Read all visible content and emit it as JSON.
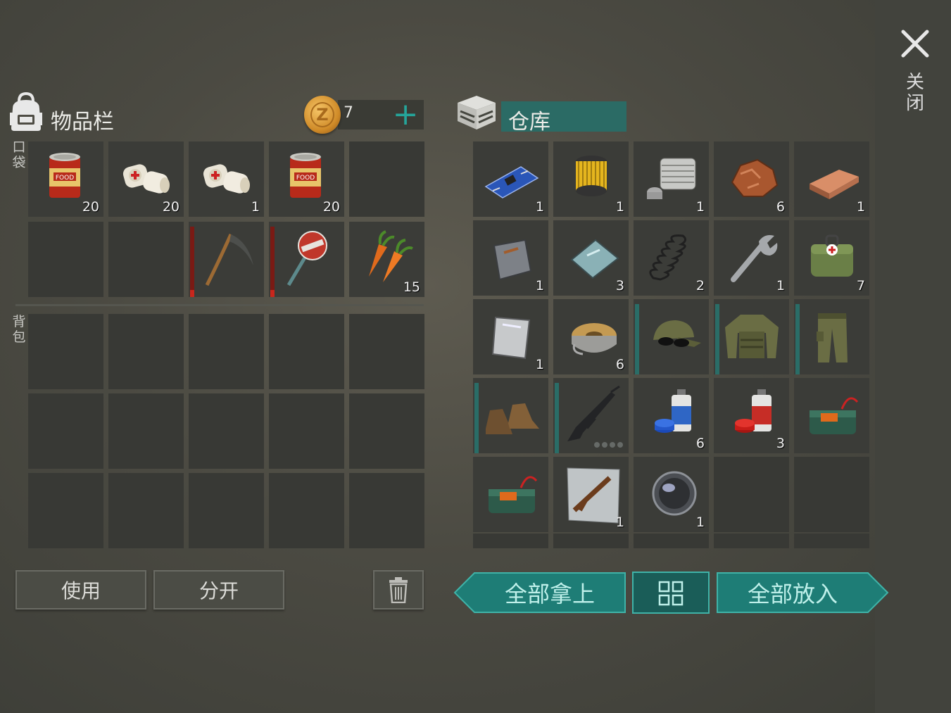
{
  "inventory": {
    "title": "物品栏",
    "coins": "7",
    "pocket_label": "口袋",
    "backpack_label": "背包"
  },
  "pocket": [
    {
      "icon": "food-can-icon",
      "count": "20"
    },
    {
      "icon": "bandage-icon",
      "count": "20"
    },
    {
      "icon": "bandage-icon",
      "count": "1"
    },
    {
      "icon": "food-can-icon",
      "count": "20"
    },
    {
      "icon": null,
      "count": ""
    },
    {
      "icon": null,
      "count": ""
    },
    {
      "icon": null,
      "count": ""
    },
    {
      "icon": "scythe-icon",
      "count": "",
      "durability": 0.08
    },
    {
      "icon": "stop-sign-icon",
      "count": "",
      "durability": 0.08
    },
    {
      "icon": "carrot-icon",
      "count": "15"
    }
  ],
  "storage": {
    "title": "仓库"
  },
  "storage_items": [
    {
      "icon": "circuit-board-icon",
      "count": "1"
    },
    {
      "icon": "air-filter-icon",
      "count": "1"
    },
    {
      "icon": "engine-cylinder-icon",
      "count": "1"
    },
    {
      "icon": "copper-ore-icon",
      "count": "6"
    },
    {
      "icon": "copper-ingot-icon",
      "count": "1"
    },
    {
      "icon": "metal-plate-icon",
      "count": "1"
    },
    {
      "icon": "glass-plate-icon",
      "count": "3"
    },
    {
      "icon": "spring-icon",
      "count": "2"
    },
    {
      "icon": "wrench-icon",
      "count": "1"
    },
    {
      "icon": "medical-bag-icon",
      "count": "7"
    },
    {
      "icon": "aluminum-plate-icon",
      "count": "1"
    },
    {
      "icon": "wire-spool-icon",
      "count": "6"
    },
    {
      "icon": "camo-cap-icon",
      "count": "",
      "durability": 1
    },
    {
      "icon": "camo-jacket-icon",
      "count": "",
      "durability": 1
    },
    {
      "icon": "camo-pants-icon",
      "count": "",
      "durability": 1
    },
    {
      "icon": "boots-icon",
      "count": "",
      "durability": 1
    },
    {
      "icon": "assault-rifle-icon",
      "count": "",
      "durability": 1,
      "ammo_dots": 4
    },
    {
      "icon": "blue-spray-paint-icon",
      "count": "6"
    },
    {
      "icon": "red-spray-paint-icon",
      "count": "3"
    },
    {
      "icon": "c4-explosive-icon",
      "count": ""
    },
    {
      "icon": "c4-explosive-icon",
      "count": ""
    },
    {
      "icon": "rifle-blueprint-icon",
      "count": "1"
    },
    {
      "icon": "lens-icon",
      "count": "1"
    },
    {
      "icon": null,
      "count": ""
    },
    {
      "icon": null,
      "count": ""
    }
  ],
  "buttons": {
    "use": "使用",
    "split": "分开",
    "take_all": "全部拿上",
    "put_all": "全部放入",
    "close": "关闭"
  },
  "colors": {
    "accent": "#25a59a",
    "button_teal": "#1e7d76",
    "durability_low": "#c8261c"
  }
}
